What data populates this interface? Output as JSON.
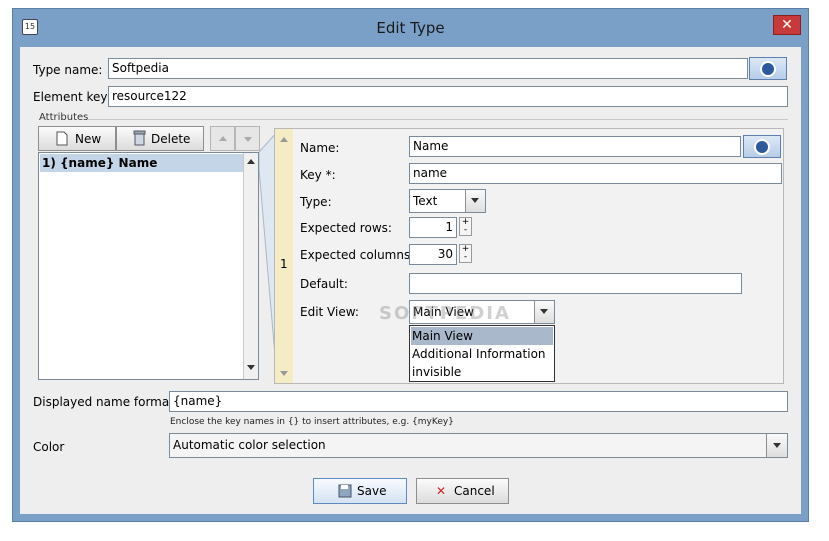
{
  "window": {
    "title": "Edit Type",
    "close_glyph": "✕",
    "app_icon_text": "15"
  },
  "type_name": {
    "label": "Type name:",
    "value": "Softpedia"
  },
  "element_key": {
    "label": "Element key:",
    "value": "resource122"
  },
  "attributes": {
    "group_label": "Attributes",
    "new_button": "New",
    "delete_button": "Delete",
    "items": [
      {
        "label": "1) {name} Name",
        "selected": true
      }
    ]
  },
  "detail": {
    "index": "1",
    "name": {
      "label": "Name:",
      "value": "Name"
    },
    "key": {
      "label": "Key *:",
      "value": "name"
    },
    "type": {
      "label": "Type:",
      "value": "Text"
    },
    "expected_rows": {
      "label": "Expected rows:",
      "value": "1"
    },
    "expected_columns": {
      "label": "Expected columns:",
      "value": "30"
    },
    "default": {
      "label": "Default:",
      "value": ""
    },
    "edit_view": {
      "label": "Edit View:",
      "value": "Main View",
      "options": [
        "Main View",
        "Additional Information",
        "invisible"
      ],
      "highlighted_index": 0
    },
    "watermark": "SOFTPEDIA"
  },
  "displayed_name_format": {
    "label": "Displayed name format:",
    "value": "{name}",
    "hint": "Enclose the key names in {} to insert attributes, e.g. {myKey}"
  },
  "color": {
    "label": "Color",
    "value": "Automatic color selection"
  },
  "buttons": {
    "save": "Save",
    "cancel": "Cancel",
    "cancel_glyph": "✕"
  },
  "icons": [
    "app-icon",
    "globe-icon",
    "new-document-icon",
    "trash-icon",
    "arrow-up-icon",
    "arrow-down-icon",
    "chevron-down-icon",
    "save-disk-icon",
    "cancel-x-icon"
  ],
  "colors": {
    "title_bar": "#7aa0c8",
    "selection": "#c5d5e8",
    "popup_highlight": "#aab8cc",
    "close_button": "#c8393a"
  }
}
